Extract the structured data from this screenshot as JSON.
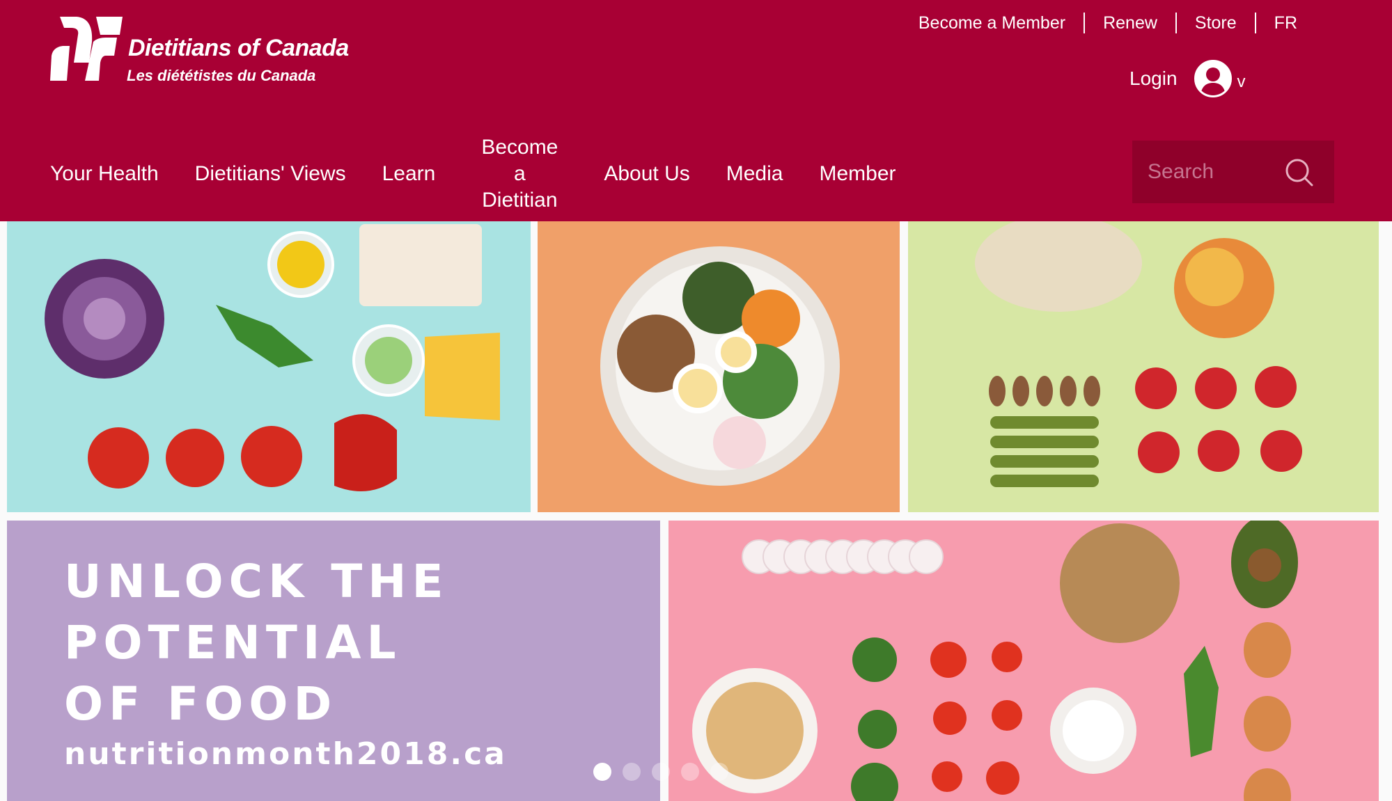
{
  "brand": {
    "name_en": "Dietitians of Canada",
    "name_fr": "Les diététistes du Canada",
    "color": "#a80034"
  },
  "utility_nav": [
    {
      "label": "Become a Member"
    },
    {
      "label": "Renew"
    },
    {
      "label": "Store"
    },
    {
      "label": "FR"
    }
  ],
  "account": {
    "login_label": "Login",
    "avatar_icon": "user-avatar-icon",
    "caret": "v"
  },
  "main_nav": [
    {
      "label": "Your Health"
    },
    {
      "label": "Dietitians' Views"
    },
    {
      "label": "Learn"
    },
    {
      "label": "Become a Dietitian"
    },
    {
      "label": "About Us"
    },
    {
      "label": "Media"
    },
    {
      "label": "Member"
    }
  ],
  "search": {
    "placeholder": "Search",
    "icon": "search-icon"
  },
  "hero": {
    "headline_lines": [
      "UNLOCK THE",
      "POTENTIAL",
      "OF FOOD"
    ],
    "url": "nutritionmonth2018.ca",
    "slides_total": 5,
    "active_slide": 1,
    "tile_colors": [
      "#a9e3e2",
      "#f0a069",
      "#d7e7a4",
      "#b8a0cb",
      "#f79cae"
    ]
  }
}
